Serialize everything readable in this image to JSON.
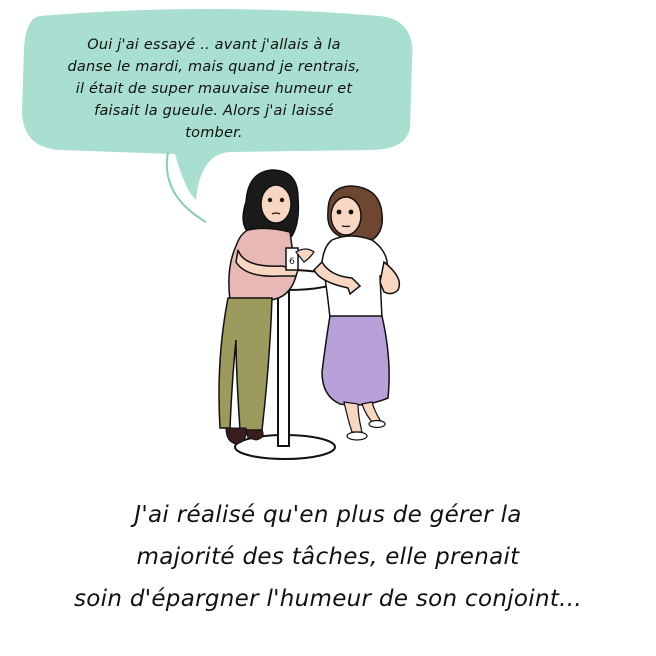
{
  "speech_bubble": {
    "lines": [
      "Oui j'ai essayé .. avant j'allais à la",
      "danse le mardi, mais quand je rentrais,",
      "il était de super mauvaise humeur et",
      "faisait la gueule. Alors j'ai laissé",
      "tomber."
    ]
  },
  "caption": {
    "lines": [
      "J'ai réalisé qu'en plus de gérer la",
      "majorité des tâches, elle prenait",
      "soin d'épargner l'humeur de son conjoint..."
    ]
  },
  "colors": {
    "bubble": "#a8dfd0",
    "woman_left_top": "#e8b8b4",
    "woman_left_pants": "#9c9a5c",
    "woman_left_hair": "#1a1a1a",
    "woman_right_hair": "#6e4632",
    "woman_right_top": "#ffffff",
    "woman_right_skirt": "#b8a0d8",
    "skin": "#f7d6c2",
    "table": "#ffffff",
    "outline": "#111111"
  }
}
